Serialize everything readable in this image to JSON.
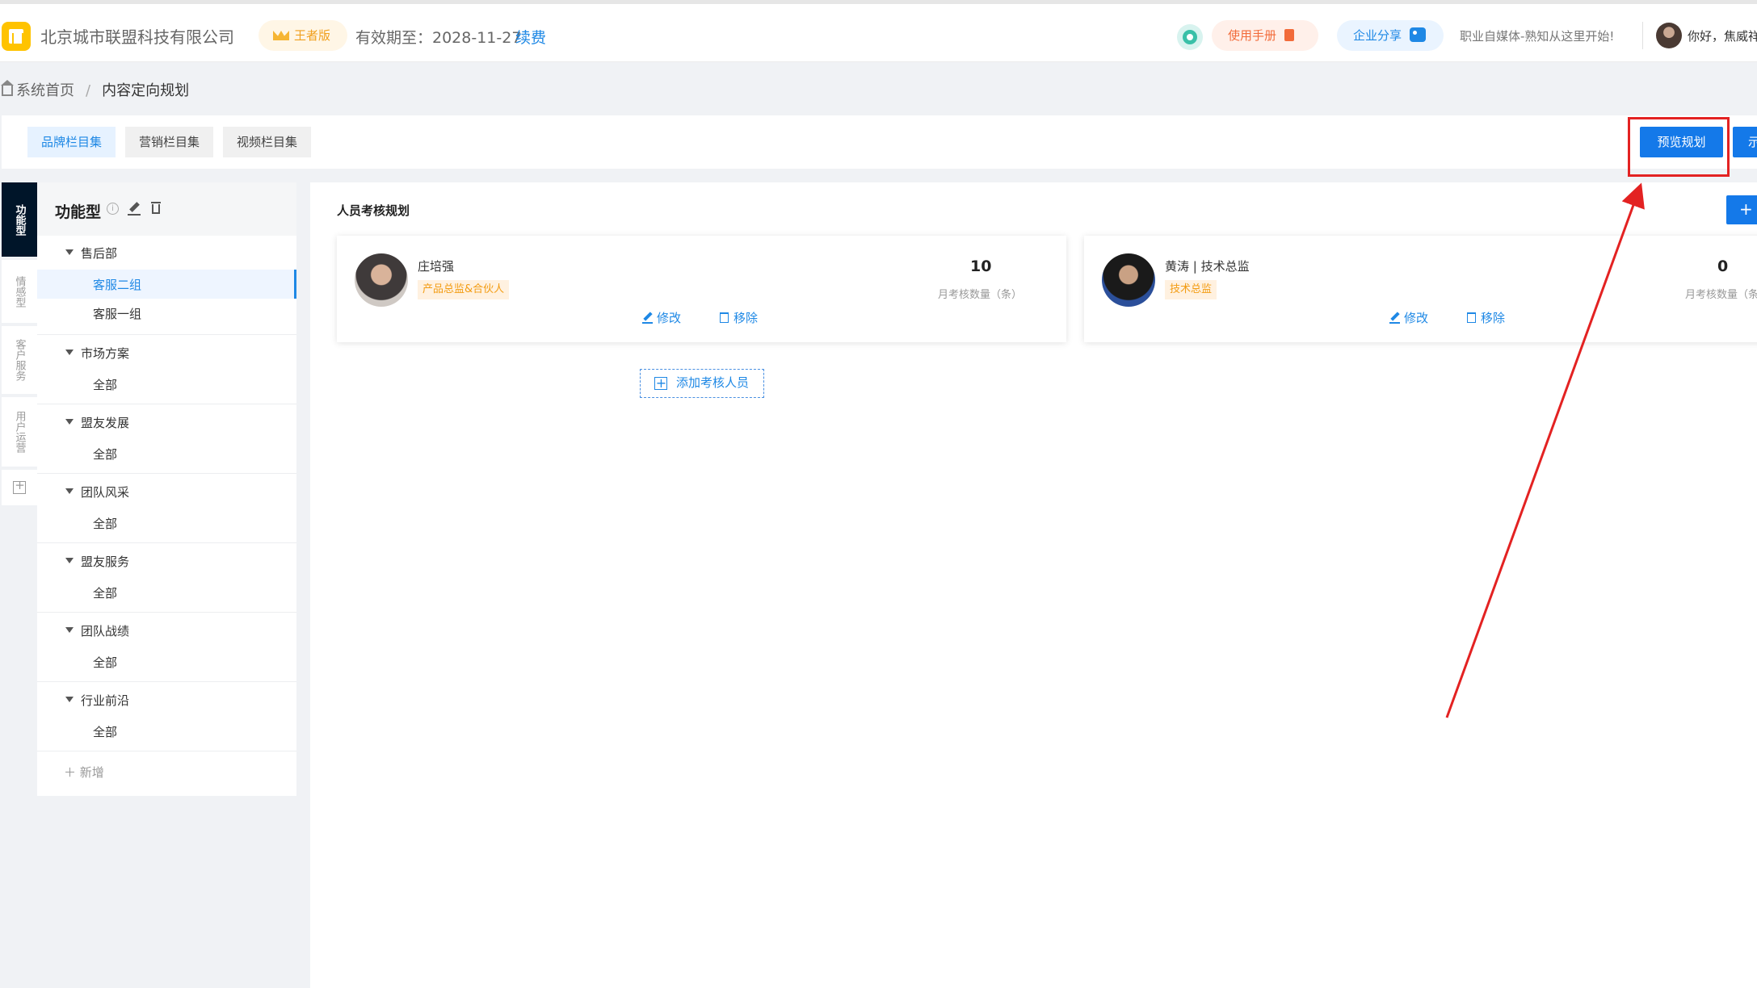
{
  "header": {
    "company_name": "北京城市联盟科技有限公司",
    "edition_label": "王者版",
    "expiry_text": "有效期至：2028-11-27",
    "renew_label": "续费",
    "manual_label": "使用手册",
    "share_label": "企业分享",
    "slogan": "职业自媒体-熟知从这里开始!",
    "greeting": "你好，焦威祥"
  },
  "breadcrumb": {
    "home": "系统首页",
    "separator": "/",
    "current": "内容定向规划"
  },
  "tabs": [
    {
      "label": "品牌栏目集",
      "active": true
    },
    {
      "label": "营销栏目集",
      "active": false
    },
    {
      "label": "视频栏目集",
      "active": false
    }
  ],
  "toolbar": {
    "preview_label": "预览规划",
    "extra_label": "示"
  },
  "vertical_tabs": [
    {
      "label": "功能型",
      "active": true
    },
    {
      "label": "情感型",
      "active": false
    },
    {
      "label": "客户服务",
      "active": false
    },
    {
      "label": "用户运营",
      "active": false
    }
  ],
  "tree": {
    "title": "功能型",
    "info_glyph": "i",
    "groups": [
      {
        "label": "售后部",
        "items": [
          "客服二组",
          "客服一组"
        ],
        "active_index": 0
      },
      {
        "label": "市场方案",
        "items": [
          "全部"
        ]
      },
      {
        "label": "盟友发展",
        "items": [
          "全部"
        ]
      },
      {
        "label": "团队风采",
        "items": [
          "全部"
        ]
      },
      {
        "label": "盟友服务",
        "items": [
          "全部"
        ]
      },
      {
        "label": "团队战绩",
        "items": [
          "全部"
        ]
      },
      {
        "label": "行业前沿",
        "items": [
          "全部"
        ]
      }
    ],
    "add_label": "＋ 新增"
  },
  "main": {
    "section_title": "人员考核规划",
    "add_button_label": "+ 新",
    "cards": [
      {
        "name": "庄培强",
        "tag": "产品总监&合伙人",
        "count": "10",
        "count_label": "月考核数量（条）",
        "edit_label": "修改",
        "remove_label": "移除"
      },
      {
        "name": "黄涛 | 技术总监",
        "tag": "技术总监",
        "count": "0",
        "count_label": "月考核数量（条）",
        "edit_label": "修改",
        "remove_label": "移除"
      }
    ],
    "add_member_label": "添加考核人员"
  },
  "colors": {
    "primary": "#1479e9",
    "link": "#1e88e5",
    "highlight": "#e32222",
    "tag_text": "#f39c12",
    "sidebar_dark": "#001529"
  }
}
